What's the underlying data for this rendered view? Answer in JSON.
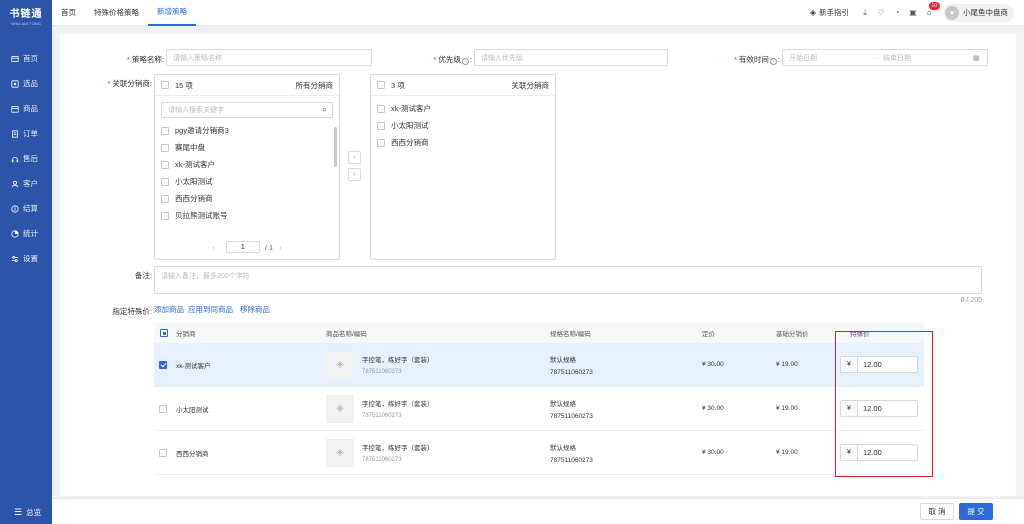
{
  "sidebar": {
    "logo_title": "书链通",
    "logo_sub": "SHULIAN TONG",
    "items": [
      {
        "label": "首页",
        "icon": "home-icon"
      },
      {
        "label": "选品",
        "icon": "select-product-icon"
      },
      {
        "label": "商品",
        "icon": "product-icon"
      },
      {
        "label": "订单",
        "icon": "order-icon"
      },
      {
        "label": "售后",
        "icon": "after-sale-icon"
      },
      {
        "label": "客户",
        "icon": "customer-icon"
      },
      {
        "label": "结算",
        "icon": "settlement-icon"
      },
      {
        "label": "统计",
        "icon": "stats-icon"
      },
      {
        "label": "设置",
        "icon": "settings-icon"
      }
    ],
    "collapse_label": "总览"
  },
  "topbar": {
    "tabs": [
      "首页",
      "特殊价格策略",
      "新增策略"
    ],
    "active_tab": 2,
    "guide_label": "新手指引",
    "notification_count": "10",
    "username": "小尾鱼中盘商"
  },
  "form": {
    "name_label": "策略名称:",
    "name_placeholder": "请输入策略名称",
    "priority_label": "优先级",
    "priority_placeholder": "请输入优先级",
    "valid_label": "有效时间",
    "start_placeholder": "开始日期",
    "date_sep": "→",
    "end_placeholder": "结束日期",
    "dist_label": "关联分销商:",
    "remark_label": "备注:",
    "remark_placeholder": "请输入备注，最多200个字符",
    "remark_counter": "0 / 200",
    "special_label": "指定特殊价:",
    "links": [
      "添加商品",
      "应用到同商品",
      "移除商品"
    ]
  },
  "transfer": {
    "left": {
      "count": "15 项",
      "title": "所有分销商",
      "search_placeholder": "请输入搜索关键字",
      "items": [
        "pgy邀请分销商3",
        "赛尾中盘",
        "xk-测试客户",
        "小太阳测试",
        "西西分销商",
        "贝拉熊测试账号"
      ],
      "page": "1",
      "total": "/ 1"
    },
    "right": {
      "count": "3 项",
      "title": "关联分销商",
      "items": [
        "xk-测试客户",
        "小太阳测试",
        "西西分销商"
      ]
    }
  },
  "table": {
    "headers": [
      "分销商",
      "商品名称/编码",
      "规格名称/编码",
      "定价",
      "基础分销价",
      "特殊价"
    ],
    "rows": [
      {
        "dist": "xk-测试客户",
        "product": "字控笔，练好字（套装）",
        "code": "787511060273",
        "spec": "默认规格",
        "spec_code": "787511060273",
        "price": "¥ 30.00",
        "base": "¥ 19.00",
        "currency": "¥",
        "special": "12.00",
        "checked": true
      },
      {
        "dist": "小太阳测试",
        "product": "字控笔，练好字（套装）",
        "code": "787511060273",
        "spec": "默认规格",
        "spec_code": "787511060273",
        "price": "¥ 30.00",
        "base": "¥ 19.00",
        "currency": "¥",
        "special": "12.00",
        "checked": false
      },
      {
        "dist": "西西分销商",
        "product": "字控笔，练好字（套装）",
        "code": "787511060273",
        "spec": "默认规格",
        "spec_code": "787511060273",
        "price": "¥ 30.00",
        "base": "¥ 19.00",
        "currency": "¥",
        "special": "12.00",
        "checked": false
      }
    ]
  },
  "footer": {
    "cancel_label": "取 消",
    "submit_label": "提 交"
  },
  "colors": {
    "sidebar": "#2b55a8",
    "accent": "#2b6bd8",
    "highlight": "#e02020"
  }
}
